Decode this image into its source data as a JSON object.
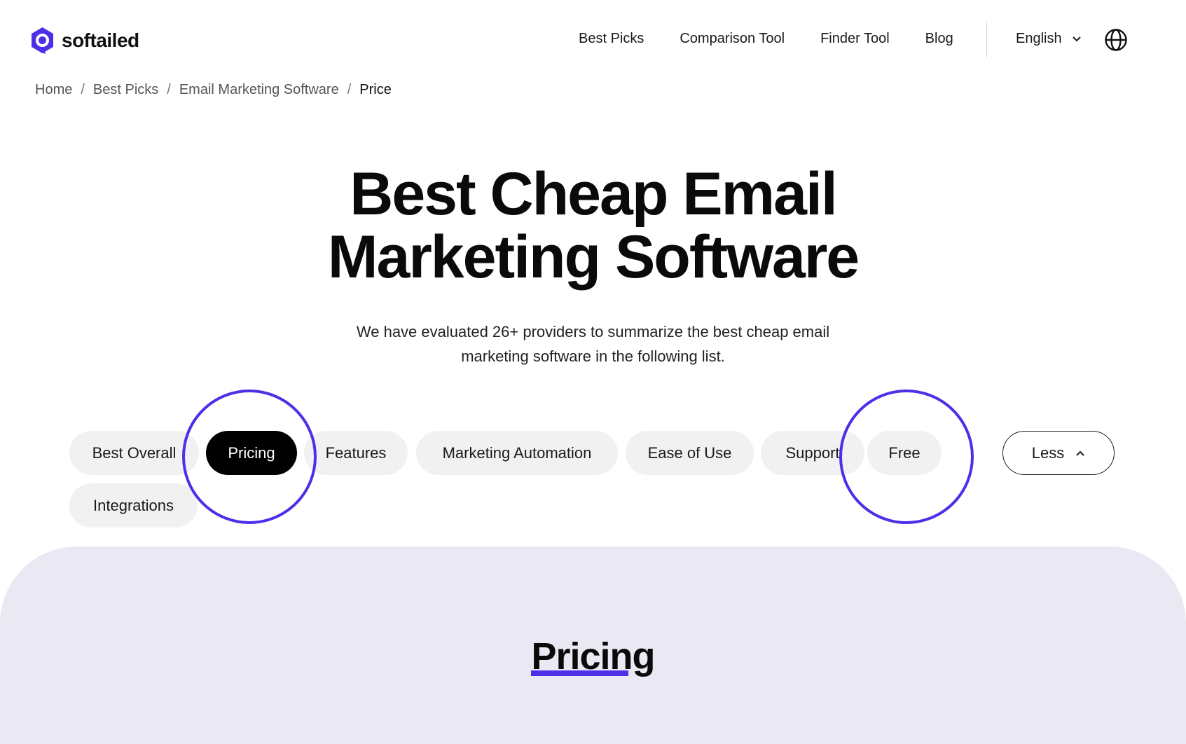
{
  "brand": {
    "name": "softailed",
    "accent_color": "#4f2ee8"
  },
  "nav": {
    "links": [
      "Best Picks",
      "Comparison Tool",
      "Finder Tool",
      "Blog"
    ],
    "language": "English",
    "globe_icon": "globe-icon"
  },
  "breadcrumb": [
    "Home",
    "Best Picks",
    "Email Marketing Software",
    "Price"
  ],
  "hero": {
    "title_part1": "Best ",
    "title_highlight": "Cheap",
    "title_part2": " Email",
    "title_line2": "Marketing Software",
    "subtitle_line1": "We have evaluated 26+ providers to summarize the best cheap email",
    "subtitle_line2": "marketing software in the following list."
  },
  "filters": {
    "chips": [
      "Best Overall",
      "Pricing",
      "Features",
      "Marketing Automation",
      "Ease of Use",
      "Support",
      "Free",
      "Integrations"
    ],
    "active": "Pricing",
    "toggle_label": "Less"
  },
  "section": {
    "title": "Pricing",
    "background": "#eae8f3"
  }
}
